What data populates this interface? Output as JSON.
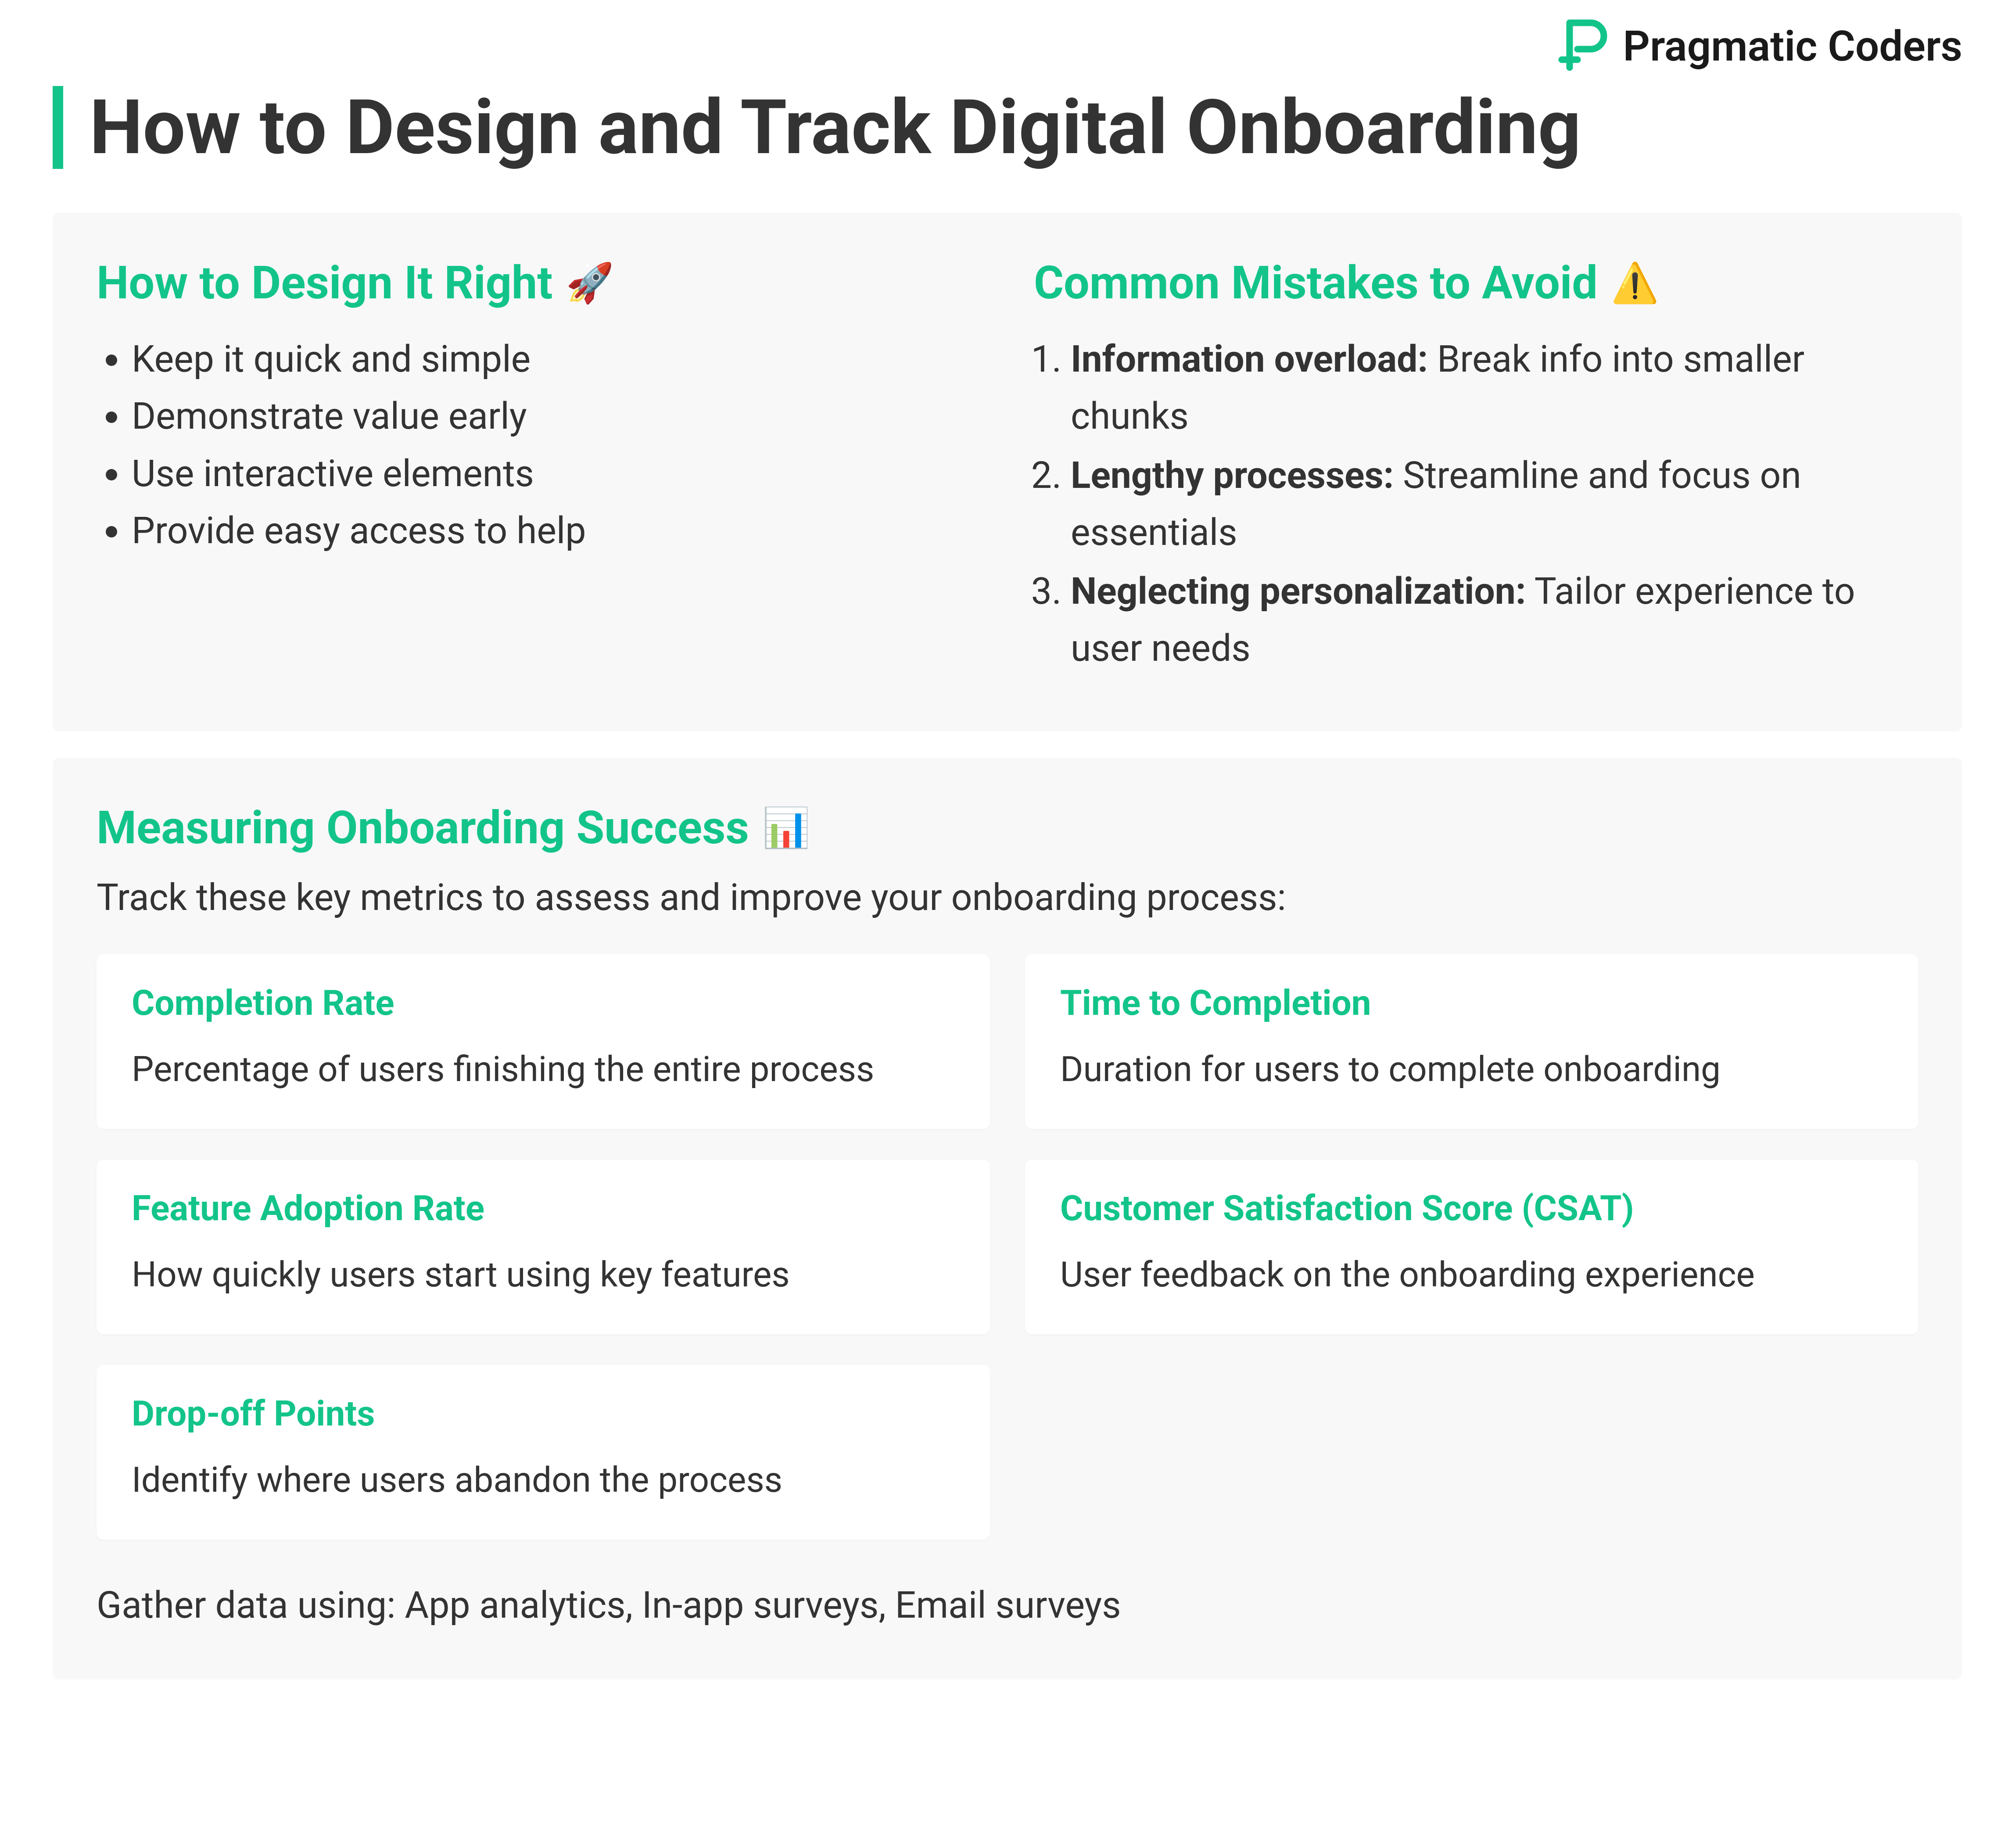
{
  "brand": {
    "name": "Pragmatic Coders",
    "accent": "#13C48A"
  },
  "title": "How to Design and Track Digital Onboarding",
  "design": {
    "heading": "How to Design It Right",
    "emoji": "🚀",
    "items": [
      "Keep it quick and simple",
      "Demonstrate value early",
      "Use interactive elements",
      "Provide easy access to help"
    ]
  },
  "mistakes": {
    "heading": "Common Mistakes to Avoid",
    "emoji": "⚠️",
    "items": [
      {
        "lead": "Information overload:",
        "rest": " Break info into smaller chunks"
      },
      {
        "lead": "Lengthy processes:",
        "rest": " Streamline and focus on essentials"
      },
      {
        "lead": "Neglecting personalization:",
        "rest": " Tailor experience to user needs"
      }
    ]
  },
  "measuring": {
    "heading": "Measuring Onboarding Success",
    "emoji": "📊",
    "intro": "Track these key metrics to assess and improve your onboarding process:",
    "metrics": [
      {
        "title": "Completion Rate",
        "desc": "Percentage of users finishing the entire process"
      },
      {
        "title": "Time to Completion",
        "desc": "Duration for users to complete onboarding"
      },
      {
        "title": "Feature Adoption Rate",
        "desc": "How quickly users start using key features"
      },
      {
        "title": "Customer Satisfaction Score (CSAT)",
        "desc": "User feedback on the onboarding experience"
      },
      {
        "title": "Drop-off Points",
        "desc": "Identify where users abandon the process"
      }
    ],
    "footer": "Gather data using: App analytics, In-app surveys, Email surveys"
  }
}
